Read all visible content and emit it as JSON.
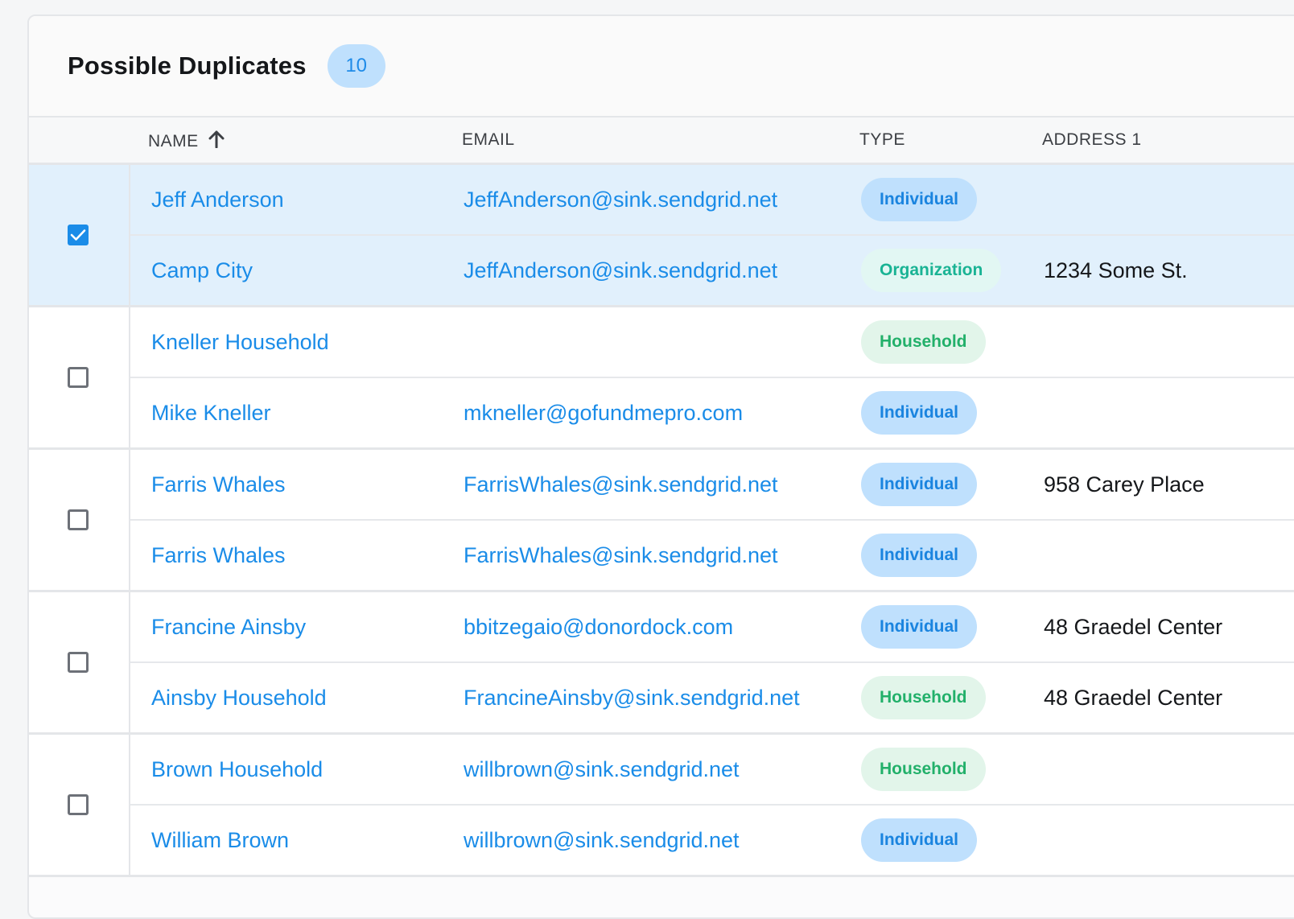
{
  "panel": {
    "title": "Possible Duplicates",
    "count": "10"
  },
  "columns": {
    "name": "NAME",
    "email": "EMAIL",
    "type": "TYPE",
    "address": "ADDRESS 1"
  },
  "groups": [
    {
      "checked": true,
      "rows": [
        {
          "name": "Jeff Anderson",
          "email": "JeffAnderson@sink.sendgrid.net",
          "type": "Individual",
          "address": ""
        },
        {
          "name": "Camp City",
          "email": "JeffAnderson@sink.sendgrid.net",
          "type": "Organization",
          "address": "1234 Some St."
        }
      ]
    },
    {
      "checked": false,
      "rows": [
        {
          "name": "Kneller Household",
          "email": "",
          "type": "Household",
          "address": ""
        },
        {
          "name": "Mike Kneller",
          "email": "mkneller@gofundmepro.com",
          "type": "Individual",
          "address": ""
        }
      ]
    },
    {
      "checked": false,
      "rows": [
        {
          "name": "Farris Whales",
          "email": "FarrisWhales@sink.sendgrid.net",
          "type": "Individual",
          "address": "958 Carey Place"
        },
        {
          "name": "Farris Whales",
          "email": "FarrisWhales@sink.sendgrid.net",
          "type": "Individual",
          "address": ""
        }
      ]
    },
    {
      "checked": false,
      "rows": [
        {
          "name": "Francine Ainsby",
          "email": "bbitzegaio@donordock.com",
          "type": "Individual",
          "address": "48 Graedel Center"
        },
        {
          "name": "Ainsby Household",
          "email": "FrancineAinsby@sink.sendgrid.net",
          "type": "Household",
          "address": "48 Graedel Center"
        }
      ]
    },
    {
      "checked": false,
      "rows": [
        {
          "name": "Brown Household",
          "email": "willbrown@sink.sendgrid.net",
          "type": "Household",
          "address": ""
        },
        {
          "name": "William Brown",
          "email": "willbrown@sink.sendgrid.net",
          "type": "Individual",
          "address": ""
        }
      ]
    }
  ],
  "colors": {
    "accent": "#1a8ce8",
    "individual_bg": "#bfe0fd",
    "household_bg": "#e2f5ea",
    "organization_bg": "#e2f7f3",
    "selected_row_bg": "#e1f0fc"
  },
  "icons": {
    "sort": "arrow-up-icon",
    "check": "checkmark-icon"
  }
}
